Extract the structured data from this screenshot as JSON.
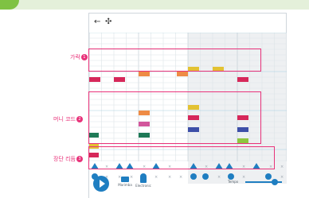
{
  "toolbar": {
    "back_icon": "←",
    "move_icon": "✣"
  },
  "annotations": [
    {
      "label": "가락",
      "number": "1"
    },
    {
      "label": "머니 코드",
      "number": "2"
    },
    {
      "label": "장단 리듬",
      "number": "3"
    }
  ],
  "instruments": [
    {
      "label": "Marimba",
      "icon": "marimba-icon"
    },
    {
      "label": "Electronic",
      "icon": "electronic-icon"
    }
  ],
  "tempo_label": "Tempo",
  "tempo_level": 0.8,
  "colors": {
    "accent": "#1f7ec1",
    "annotation": "#e8337a",
    "note_red": "#d6285a",
    "note_orange": "#ee8b45",
    "note_yellow": "#e3c233",
    "note_pink": "#d2579c",
    "note_green": "#1f7a57",
    "note_purple": "#3d4fa8",
    "note_lime": "#8dc63f",
    "banner": "#e4f0da"
  }
}
